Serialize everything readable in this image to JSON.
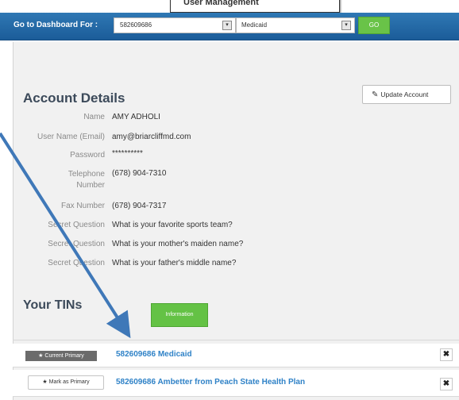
{
  "callout": {
    "text": "User Management"
  },
  "topbar": {
    "label": "Go to Dashboard For :",
    "tin_select_value": "582609686",
    "plan_select_value": "Medicaid",
    "dropdown_glyph": "▾",
    "go_label": "GO",
    "bg_color": "#2268a8",
    "go_color": "#69c348"
  },
  "account": {
    "title": "Account Details",
    "update_label": "Update Account",
    "update_icon": "pencil-icon",
    "fields": [
      {
        "label": "Name",
        "value": "AMY ADHOLI"
      },
      {
        "label": "User Name (Email)",
        "value": "amy@briarcliffmd.com"
      },
      {
        "label": "Password",
        "value": "**********"
      },
      {
        "label": "Telephone Number",
        "value": "(678) 904-7310"
      },
      {
        "label": "Fax Number",
        "value": "(678) 904-7317"
      },
      {
        "label": "Secret Question",
        "value": "What is your favorite sports team?"
      },
      {
        "label": "Secret Question",
        "value": "What is your mother's maiden name?"
      },
      {
        "label": "Secret Question",
        "value": "What is your father's middle name?"
      }
    ]
  },
  "tins": {
    "title": "Your TINs",
    "information_label": "Information",
    "rows": [
      {
        "badge": "Current Primary",
        "link": "582609686 Medicaid",
        "remove": "✖"
      },
      {
        "badge": "Mark as Primary",
        "link": "582609686 Ambetter from Peach State Health Plan",
        "remove": "✖"
      }
    ]
  },
  "annotation": {
    "arrow_color": "#3f78b8"
  }
}
